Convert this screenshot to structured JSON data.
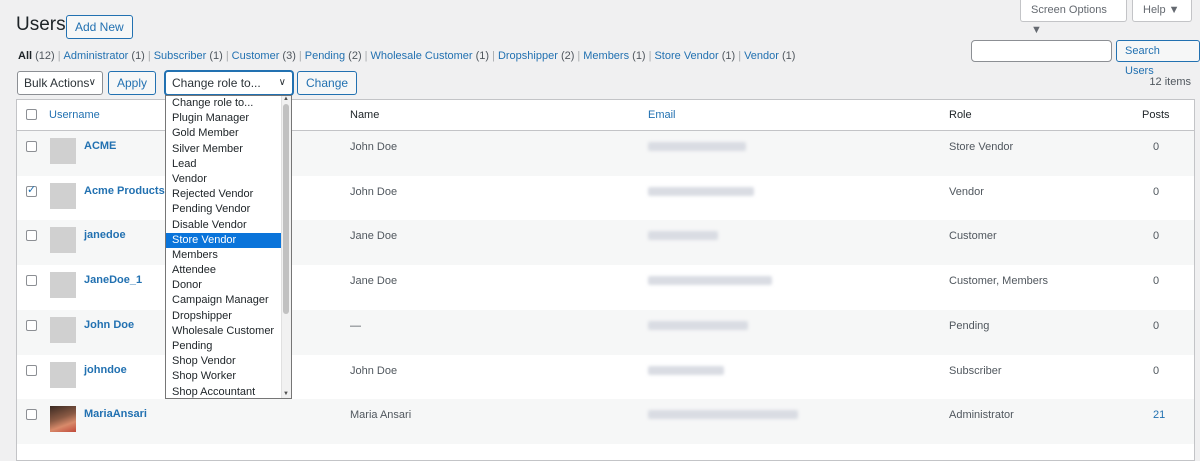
{
  "top_tabs": {
    "screen_options": "Screen Options ▼",
    "help": "Help ▼"
  },
  "header": {
    "title": "Users",
    "add_new": "Add New"
  },
  "views": [
    {
      "label": "All",
      "count": "(12)",
      "current": true
    },
    {
      "label": "Administrator",
      "count": "(1)"
    },
    {
      "label": "Subscriber",
      "count": "(1)"
    },
    {
      "label": "Customer",
      "count": "(3)"
    },
    {
      "label": "Pending",
      "count": "(2)"
    },
    {
      "label": "Wholesale Customer",
      "count": "(1)"
    },
    {
      "label": "Dropshipper",
      "count": "(2)"
    },
    {
      "label": "Members",
      "count": "(1)"
    },
    {
      "label": "Store Vendor",
      "count": "(1)"
    },
    {
      "label": "Vendor",
      "count": "(1)"
    }
  ],
  "search": {
    "button": "Search Users",
    "value": ""
  },
  "toolbar": {
    "bulk_actions": "Bulk Actions",
    "apply": "Apply",
    "change_role": "Change role to...",
    "change": "Change",
    "items_count": "12 items"
  },
  "table": {
    "headers": {
      "username": "Username",
      "name": "Name",
      "email": "Email",
      "role": "Role",
      "posts": "Posts"
    },
    "rows": [
      {
        "username": "ACME",
        "name": "John Doe",
        "role": "Store Vendor",
        "posts": "0",
        "checked": false
      },
      {
        "username": "Acme Products",
        "name": "John Doe",
        "role": "Vendor",
        "posts": "0",
        "checked": true
      },
      {
        "username": "janedoe",
        "name": "Jane Doe",
        "role": "Customer",
        "posts": "0",
        "checked": false
      },
      {
        "username": "JaneDoe_1",
        "name": "Jane Doe",
        "role": "Customer, Members",
        "posts": "0",
        "checked": false
      },
      {
        "username": "John Doe",
        "name": "—",
        "role": "Pending",
        "posts": "0",
        "checked": false
      },
      {
        "username": "johndoe",
        "name": "John Doe",
        "role": "Subscriber",
        "posts": "0",
        "checked": false
      },
      {
        "username": "MariaAnsari",
        "name": "Maria Ansari",
        "role": "Administrator",
        "posts": "21",
        "checked": false
      }
    ]
  },
  "role_dropdown": {
    "selected": "Store Vendor",
    "options": [
      "Change role to...",
      "Plugin Manager",
      "Gold Member",
      "Silver Member",
      "Lead",
      "Vendor",
      "Rejected Vendor",
      "Pending Vendor",
      "Disable Vendor",
      "Store Vendor",
      "Members",
      "Attendee",
      "Donor",
      "Campaign Manager",
      "Dropshipper",
      "Wholesale Customer",
      "Pending",
      "Shop Vendor",
      "Shop Worker",
      "Shop Accountant"
    ]
  },
  "colors": {
    "accent": "#2271b1",
    "selected_option": "#0a74da",
    "background": "#f0f0f1"
  }
}
